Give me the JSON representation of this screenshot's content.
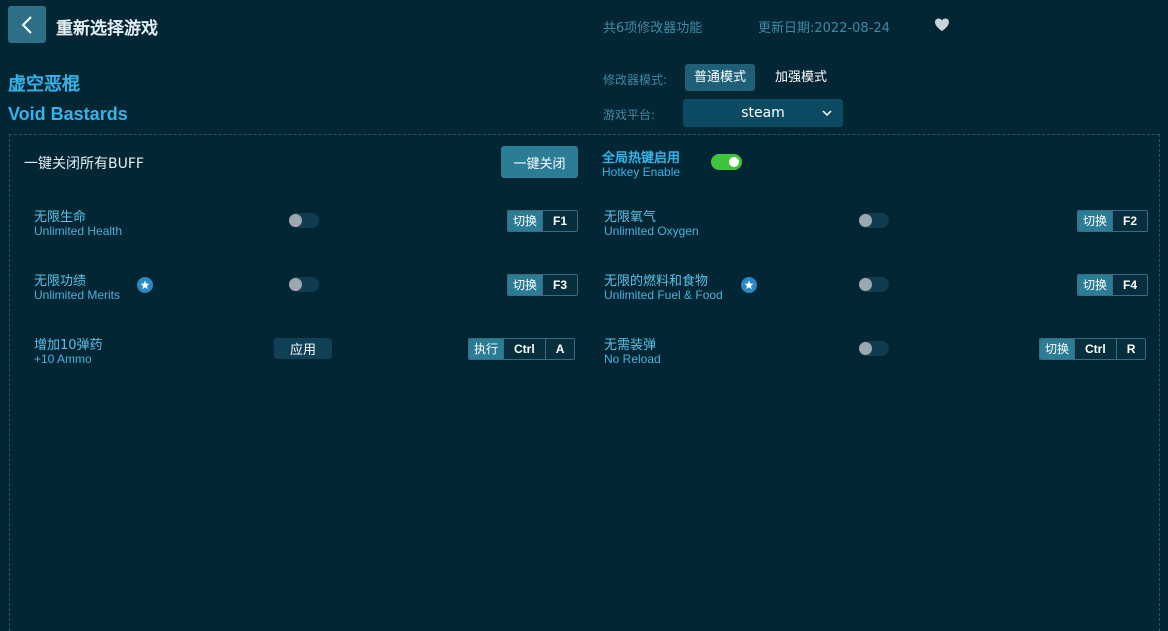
{
  "header": {
    "title": "重新选择游戏",
    "feature_count": "共6项修改器功能",
    "update_date": "更新日期:2022-08-24"
  },
  "game": {
    "name_cn": "虚空恶棍",
    "name_en": "Void Bastards"
  },
  "mode": {
    "label": "修改器模式:",
    "normal": "普通模式",
    "enhanced": "加强模式",
    "selected": "普通模式"
  },
  "platform": {
    "label": "游戏平台:",
    "value": "steam"
  },
  "global": {
    "disable_all_label": "一键关闭所有BUFF",
    "disable_all_button": "一键关闭",
    "hotkey_title": "全局热键启用",
    "hotkey_subtitle": "Hotkey Enable",
    "hotkey_enabled": true
  },
  "cheats": [
    {
      "cn": "无限生命",
      "en": "Unlimited Health",
      "action": "切换",
      "keys": [
        "F1"
      ],
      "star": false
    },
    {
      "cn": "无限氧气",
      "en": "Unlimited Oxygen",
      "action": "切换",
      "keys": [
        "F2"
      ],
      "star": false
    },
    {
      "cn": "无限功绩",
      "en": "Unlimited Merits",
      "action": "切换",
      "keys": [
        "F3"
      ],
      "star": true
    },
    {
      "cn": "无限的燃料和食物",
      "en": "Unlimited Fuel & Food",
      "action": "切换",
      "keys": [
        "F4"
      ],
      "star": true
    },
    {
      "cn": "增加10弹药",
      "en": "+10 Ammo",
      "action": "执行",
      "keys": [
        "Ctrl",
        "A"
      ],
      "star": false,
      "apply_label": "应用"
    },
    {
      "cn": "无需装弹",
      "en": "No Reload",
      "action": "切换",
      "keys": [
        "Ctrl",
        "R"
      ],
      "star": false
    }
  ],
  "colors": {
    "background": "#032634",
    "accent": "#35b3e8",
    "button": "#2b7d96",
    "toggle_on": "#3fc23c"
  }
}
